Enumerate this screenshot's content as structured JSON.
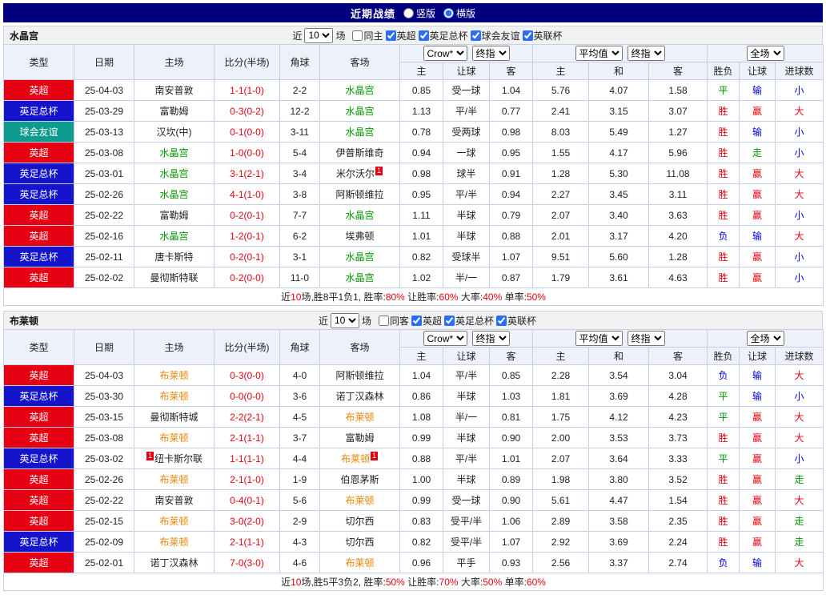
{
  "topbar": {
    "title": "近期战绩",
    "radio_vertical": "竖版",
    "radio_horizontal": "横版"
  },
  "controls": {
    "near": "近",
    "count": "10",
    "games": "场"
  },
  "colors": {
    "league": {
      "英超": "#e60012",
      "英足总杯": "#1414cc",
      "球会友谊": "#0f9b8f",
      "英联杯": "#1414cc"
    },
    "team_hl": {
      "green": "#009900",
      "orange": "#e8860a"
    },
    "result": {
      "r": "#e60012",
      "g": "#009900",
      "b": "#0000e6"
    }
  },
  "table_header": {
    "static_cols": [
      "类型",
      "日期",
      "主场",
      "比分(半场)",
      "角球",
      "客场"
    ],
    "group1": {
      "select1": "Crow*",
      "select2": "终指",
      "subs": [
        "主",
        "让球",
        "客"
      ]
    },
    "group2": {
      "select1": "平均值",
      "select2": "终指",
      "subs": [
        "主",
        "和",
        "客"
      ]
    },
    "group3": {
      "select1": "全场",
      "subs": [
        "胜负",
        "让球",
        "进球数"
      ]
    }
  },
  "sections": [
    {
      "team": "水晶宫",
      "same_label": "同主",
      "same_checked": false,
      "leagues": [
        {
          "label": "英超",
          "checked": true
        },
        {
          "label": "英足总杯",
          "checked": true
        },
        {
          "label": "球会友谊",
          "checked": true
        },
        {
          "label": "英联杯",
          "checked": true
        }
      ],
      "rows": [
        {
          "type": "英超",
          "date": "25-04-03",
          "home": {
            "n": "南安普敦"
          },
          "score": "1-1(1-0)",
          "corner": "2-2",
          "away": {
            "n": "水晶宫",
            "hl": "green"
          },
          "odds": [
            "0.85",
            "受一球",
            "1.04"
          ],
          "avg": [
            "5.76",
            "4.07",
            "1.58"
          ],
          "res": [
            {
              "t": "平",
              "c": "g"
            },
            {
              "t": "输",
              "c": "b"
            },
            {
              "t": "小",
              "c": "b"
            }
          ]
        },
        {
          "type": "英足总杯",
          "date": "25-03-29",
          "home": {
            "n": "富勒姆"
          },
          "score": "0-3(0-2)",
          "corner": "12-2",
          "away": {
            "n": "水晶宫",
            "hl": "green"
          },
          "odds": [
            "1.13",
            "平/半",
            "0.77"
          ],
          "avg": [
            "2.41",
            "3.15",
            "3.07"
          ],
          "res": [
            {
              "t": "胜",
              "c": "r"
            },
            {
              "t": "赢",
              "c": "r"
            },
            {
              "t": "大",
              "c": "r"
            }
          ]
        },
        {
          "type": "球会友谊",
          "date": "25-03-13",
          "home": {
            "n": "汉坎(中)"
          },
          "score": "0-1(0-0)",
          "corner": "3-11",
          "away": {
            "n": "水晶宫",
            "hl": "green"
          },
          "odds": [
            "0.78",
            "受两球",
            "0.98"
          ],
          "avg": [
            "8.03",
            "5.49",
            "1.27"
          ],
          "res": [
            {
              "t": "胜",
              "c": "r"
            },
            {
              "t": "输",
              "c": "b"
            },
            {
              "t": "小",
              "c": "b"
            }
          ]
        },
        {
          "type": "英超",
          "date": "25-03-08",
          "home": {
            "n": "水晶宫",
            "hl": "green"
          },
          "score": "1-0(0-0)",
          "corner": "5-4",
          "away": {
            "n": "伊普斯维奇"
          },
          "odds": [
            "0.94",
            "一球",
            "0.95"
          ],
          "avg": [
            "1.55",
            "4.17",
            "5.96"
          ],
          "res": [
            {
              "t": "胜",
              "c": "r"
            },
            {
              "t": "走",
              "c": "g"
            },
            {
              "t": "小",
              "c": "b"
            }
          ]
        },
        {
          "type": "英足总杯",
          "date": "25-03-01",
          "home": {
            "n": "水晶宫",
            "hl": "green"
          },
          "score": "3-1(2-1)",
          "corner": "3-4",
          "away": {
            "n": "米尔沃尔",
            "rc_a": "1"
          },
          "odds": [
            "0.98",
            "球半",
            "0.91"
          ],
          "avg": [
            "1.28",
            "5.30",
            "11.08"
          ],
          "res": [
            {
              "t": "胜",
              "c": "r"
            },
            {
              "t": "赢",
              "c": "r"
            },
            {
              "t": "大",
              "c": "r"
            }
          ]
        },
        {
          "type": "英足总杯",
          "date": "25-02-26",
          "home": {
            "n": "水晶宫",
            "hl": "green"
          },
          "score": "4-1(1-0)",
          "corner": "3-8",
          "away": {
            "n": "阿斯顿维拉"
          },
          "odds": [
            "0.95",
            "平/半",
            "0.94"
          ],
          "avg": [
            "2.27",
            "3.45",
            "3.11"
          ],
          "res": [
            {
              "t": "胜",
              "c": "r"
            },
            {
              "t": "赢",
              "c": "r"
            },
            {
              "t": "大",
              "c": "r"
            }
          ]
        },
        {
          "type": "英超",
          "date": "25-02-22",
          "home": {
            "n": "富勒姆"
          },
          "score": "0-2(0-1)",
          "corner": "7-7",
          "away": {
            "n": "水晶宫",
            "hl": "green"
          },
          "odds": [
            "1.11",
            "半球",
            "0.79"
          ],
          "avg": [
            "2.07",
            "3.40",
            "3.63"
          ],
          "res": [
            {
              "t": "胜",
              "c": "r"
            },
            {
              "t": "赢",
              "c": "r"
            },
            {
              "t": "小",
              "c": "b"
            }
          ]
        },
        {
          "type": "英超",
          "date": "25-02-16",
          "home": {
            "n": "水晶宫",
            "hl": "green"
          },
          "score": "1-2(0-1)",
          "corner": "6-2",
          "away": {
            "n": "埃弗顿"
          },
          "odds": [
            "1.01",
            "半球",
            "0.88"
          ],
          "avg": [
            "2.01",
            "3.17",
            "4.20"
          ],
          "res": [
            {
              "t": "负",
              "c": "b"
            },
            {
              "t": "输",
              "c": "b"
            },
            {
              "t": "大",
              "c": "r"
            }
          ]
        },
        {
          "type": "英足总杯",
          "date": "25-02-11",
          "home": {
            "n": "唐卡斯特"
          },
          "score": "0-2(0-1)",
          "corner": "3-1",
          "away": {
            "n": "水晶宫",
            "hl": "green"
          },
          "odds": [
            "0.82",
            "受球半",
            "1.07"
          ],
          "avg": [
            "9.51",
            "5.60",
            "1.28"
          ],
          "res": [
            {
              "t": "胜",
              "c": "r"
            },
            {
              "t": "赢",
              "c": "r"
            },
            {
              "t": "小",
              "c": "b"
            }
          ]
        },
        {
          "type": "英超",
          "date": "25-02-02",
          "home": {
            "n": "曼彻斯特联"
          },
          "score": "0-2(0-0)",
          "corner": "11-0",
          "away": {
            "n": "水晶宫",
            "hl": "green"
          },
          "odds": [
            "1.02",
            "半/一",
            "0.87"
          ],
          "avg": [
            "1.79",
            "3.61",
            "4.63"
          ],
          "res": [
            {
              "t": "胜",
              "c": "r"
            },
            {
              "t": "赢",
              "c": "r"
            },
            {
              "t": "小",
              "c": "b"
            }
          ]
        }
      ],
      "summary": [
        {
          "t": "近",
          "c": "k"
        },
        {
          "t": "10",
          "c": "r"
        },
        {
          "t": "场,胜8平1负1, 胜率:",
          "c": "k"
        },
        {
          "t": "80%",
          "c": "r"
        },
        {
          "t": " 让胜率:",
          "c": "k"
        },
        {
          "t": "60%",
          "c": "r"
        },
        {
          "t": " 大率:",
          "c": "k"
        },
        {
          "t": "40%",
          "c": "r"
        },
        {
          "t": " 单率:",
          "c": "k"
        },
        {
          "t": "50%",
          "c": "r"
        }
      ]
    },
    {
      "team": "布莱顿",
      "same_label": "同客",
      "same_checked": false,
      "leagues": [
        {
          "label": "英超",
          "checked": true
        },
        {
          "label": "英足总杯",
          "checked": true
        },
        {
          "label": "英联杯",
          "checked": true
        }
      ],
      "rows": [
        {
          "type": "英超",
          "date": "25-04-03",
          "home": {
            "n": "布莱顿",
            "hl": "orange"
          },
          "score": "0-3(0-0)",
          "corner": "4-0",
          "away": {
            "n": "阿斯顿维拉"
          },
          "odds": [
            "1.04",
            "平/半",
            "0.85"
          ],
          "avg": [
            "2.28",
            "3.54",
            "3.04"
          ],
          "res": [
            {
              "t": "负",
              "c": "b"
            },
            {
              "t": "输",
              "c": "b"
            },
            {
              "t": "大",
              "c": "r"
            }
          ]
        },
        {
          "type": "英足总杯",
          "date": "25-03-30",
          "home": {
            "n": "布莱顿",
            "hl": "orange"
          },
          "score": "0-0(0-0)",
          "corner": "3-6",
          "away": {
            "n": "诺丁汉森林"
          },
          "odds": [
            "0.86",
            "半球",
            "1.03"
          ],
          "avg": [
            "1.81",
            "3.69",
            "4.28"
          ],
          "res": [
            {
              "t": "平",
              "c": "g"
            },
            {
              "t": "输",
              "c": "b"
            },
            {
              "t": "小",
              "c": "b"
            }
          ]
        },
        {
          "type": "英超",
          "date": "25-03-15",
          "home": {
            "n": "曼彻斯特城"
          },
          "score": "2-2(2-1)",
          "corner": "4-5",
          "away": {
            "n": "布莱顿",
            "hl": "orange"
          },
          "odds": [
            "1.08",
            "半/一",
            "0.81"
          ],
          "avg": [
            "1.75",
            "4.12",
            "4.23"
          ],
          "res": [
            {
              "t": "平",
              "c": "g"
            },
            {
              "t": "赢",
              "c": "r"
            },
            {
              "t": "大",
              "c": "r"
            }
          ]
        },
        {
          "type": "英超",
          "date": "25-03-08",
          "home": {
            "n": "布莱顿",
            "hl": "orange"
          },
          "score": "2-1(1-1)",
          "corner": "3-7",
          "away": {
            "n": "富勒姆"
          },
          "odds": [
            "0.99",
            "半球",
            "0.90"
          ],
          "avg": [
            "2.00",
            "3.53",
            "3.73"
          ],
          "res": [
            {
              "t": "胜",
              "c": "r"
            },
            {
              "t": "赢",
              "c": "r"
            },
            {
              "t": "大",
              "c": "r"
            }
          ]
        },
        {
          "type": "英足总杯",
          "date": "25-03-02",
          "home": {
            "n": "纽卡斯尔联",
            "rc_b": "1"
          },
          "score": "1-1(1-1)",
          "corner": "4-4",
          "away": {
            "n": "布莱顿",
            "hl": "orange",
            "rc_a": "1"
          },
          "odds": [
            "0.88",
            "平/半",
            "1.01"
          ],
          "avg": [
            "2.07",
            "3.64",
            "3.33"
          ],
          "res": [
            {
              "t": "平",
              "c": "g"
            },
            {
              "t": "赢",
              "c": "r"
            },
            {
              "t": "小",
              "c": "b"
            }
          ]
        },
        {
          "type": "英超",
          "date": "25-02-26",
          "home": {
            "n": "布莱顿",
            "hl": "orange"
          },
          "score": "2-1(1-0)",
          "corner": "1-9",
          "away": {
            "n": "伯恩茅斯"
          },
          "odds": [
            "1.00",
            "半球",
            "0.89"
          ],
          "avg": [
            "1.98",
            "3.80",
            "3.52"
          ],
          "res": [
            {
              "t": "胜",
              "c": "r"
            },
            {
              "t": "赢",
              "c": "r"
            },
            {
              "t": "走",
              "c": "g"
            }
          ]
        },
        {
          "type": "英超",
          "date": "25-02-22",
          "home": {
            "n": "南安普敦"
          },
          "score": "0-4(0-1)",
          "corner": "5-6",
          "away": {
            "n": "布莱顿",
            "hl": "orange"
          },
          "odds": [
            "0.99",
            "受一球",
            "0.90"
          ],
          "avg": [
            "5.61",
            "4.47",
            "1.54"
          ],
          "res": [
            {
              "t": "胜",
              "c": "r"
            },
            {
              "t": "赢",
              "c": "r"
            },
            {
              "t": "大",
              "c": "r"
            }
          ]
        },
        {
          "type": "英超",
          "date": "25-02-15",
          "home": {
            "n": "布莱顿",
            "hl": "orange"
          },
          "score": "3-0(2-0)",
          "corner": "2-9",
          "away": {
            "n": "切尔西"
          },
          "odds": [
            "0.83",
            "受平/半",
            "1.06"
          ],
          "avg": [
            "2.89",
            "3.58",
            "2.35"
          ],
          "res": [
            {
              "t": "胜",
              "c": "r"
            },
            {
              "t": "赢",
              "c": "r"
            },
            {
              "t": "走",
              "c": "g"
            }
          ]
        },
        {
          "type": "英足总杯",
          "date": "25-02-09",
          "home": {
            "n": "布莱顿",
            "hl": "orange"
          },
          "score": "2-1(1-1)",
          "corner": "4-3",
          "away": {
            "n": "切尔西"
          },
          "odds": [
            "0.82",
            "受平/半",
            "1.07"
          ],
          "avg": [
            "2.92",
            "3.69",
            "2.24"
          ],
          "res": [
            {
              "t": "胜",
              "c": "r"
            },
            {
              "t": "赢",
              "c": "r"
            },
            {
              "t": "走",
              "c": "g"
            }
          ]
        },
        {
          "type": "英超",
          "date": "25-02-01",
          "home": {
            "n": "诺丁汉森林"
          },
          "score": "7-0(3-0)",
          "corner": "4-6",
          "away": {
            "n": "布莱顿",
            "hl": "orange"
          },
          "odds": [
            "0.96",
            "平手",
            "0.93"
          ],
          "avg": [
            "2.56",
            "3.37",
            "2.74"
          ],
          "res": [
            {
              "t": "负",
              "c": "b"
            },
            {
              "t": "输",
              "c": "b"
            },
            {
              "t": "大",
              "c": "r"
            }
          ]
        }
      ],
      "summary": [
        {
          "t": "近",
          "c": "k"
        },
        {
          "t": "10",
          "c": "r"
        },
        {
          "t": "场,胜5平3负2, 胜率:",
          "c": "k"
        },
        {
          "t": "50%",
          "c": "r"
        },
        {
          "t": " 让胜率:",
          "c": "k"
        },
        {
          "t": "70%",
          "c": "r"
        },
        {
          "t": " 大率:",
          "c": "k"
        },
        {
          "t": "50%",
          "c": "r"
        },
        {
          "t": " 单率:",
          "c": "k"
        },
        {
          "t": "60%",
          "c": "r"
        }
      ]
    }
  ]
}
